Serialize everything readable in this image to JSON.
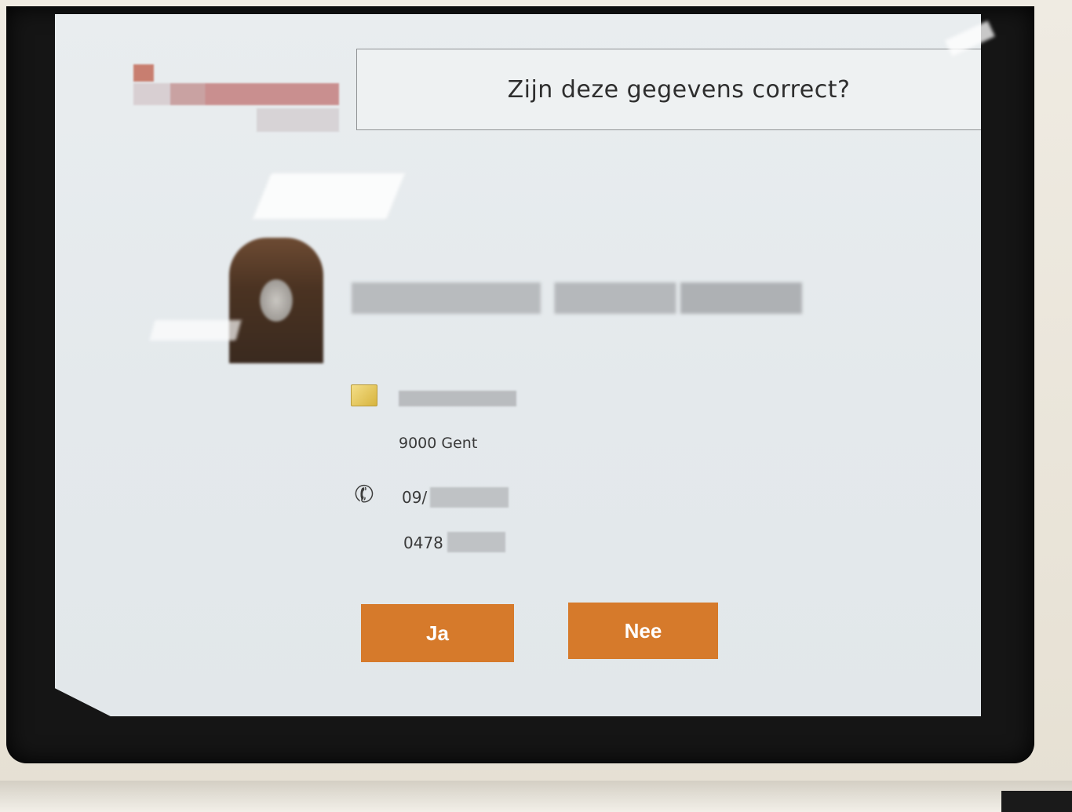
{
  "header": {
    "title": "Zijn deze gegevens correct?"
  },
  "contact": {
    "city": "9000 Gent",
    "phone_landline": "09/",
    "phone_mobile": "0478"
  },
  "actions": {
    "yes_label": "Ja",
    "no_label": "Nee"
  },
  "colors": {
    "button": "#d67a2b",
    "screen_bg": "#e7ebee"
  },
  "icons": {
    "address": "address-card-icon",
    "phone": "phone-icon"
  }
}
